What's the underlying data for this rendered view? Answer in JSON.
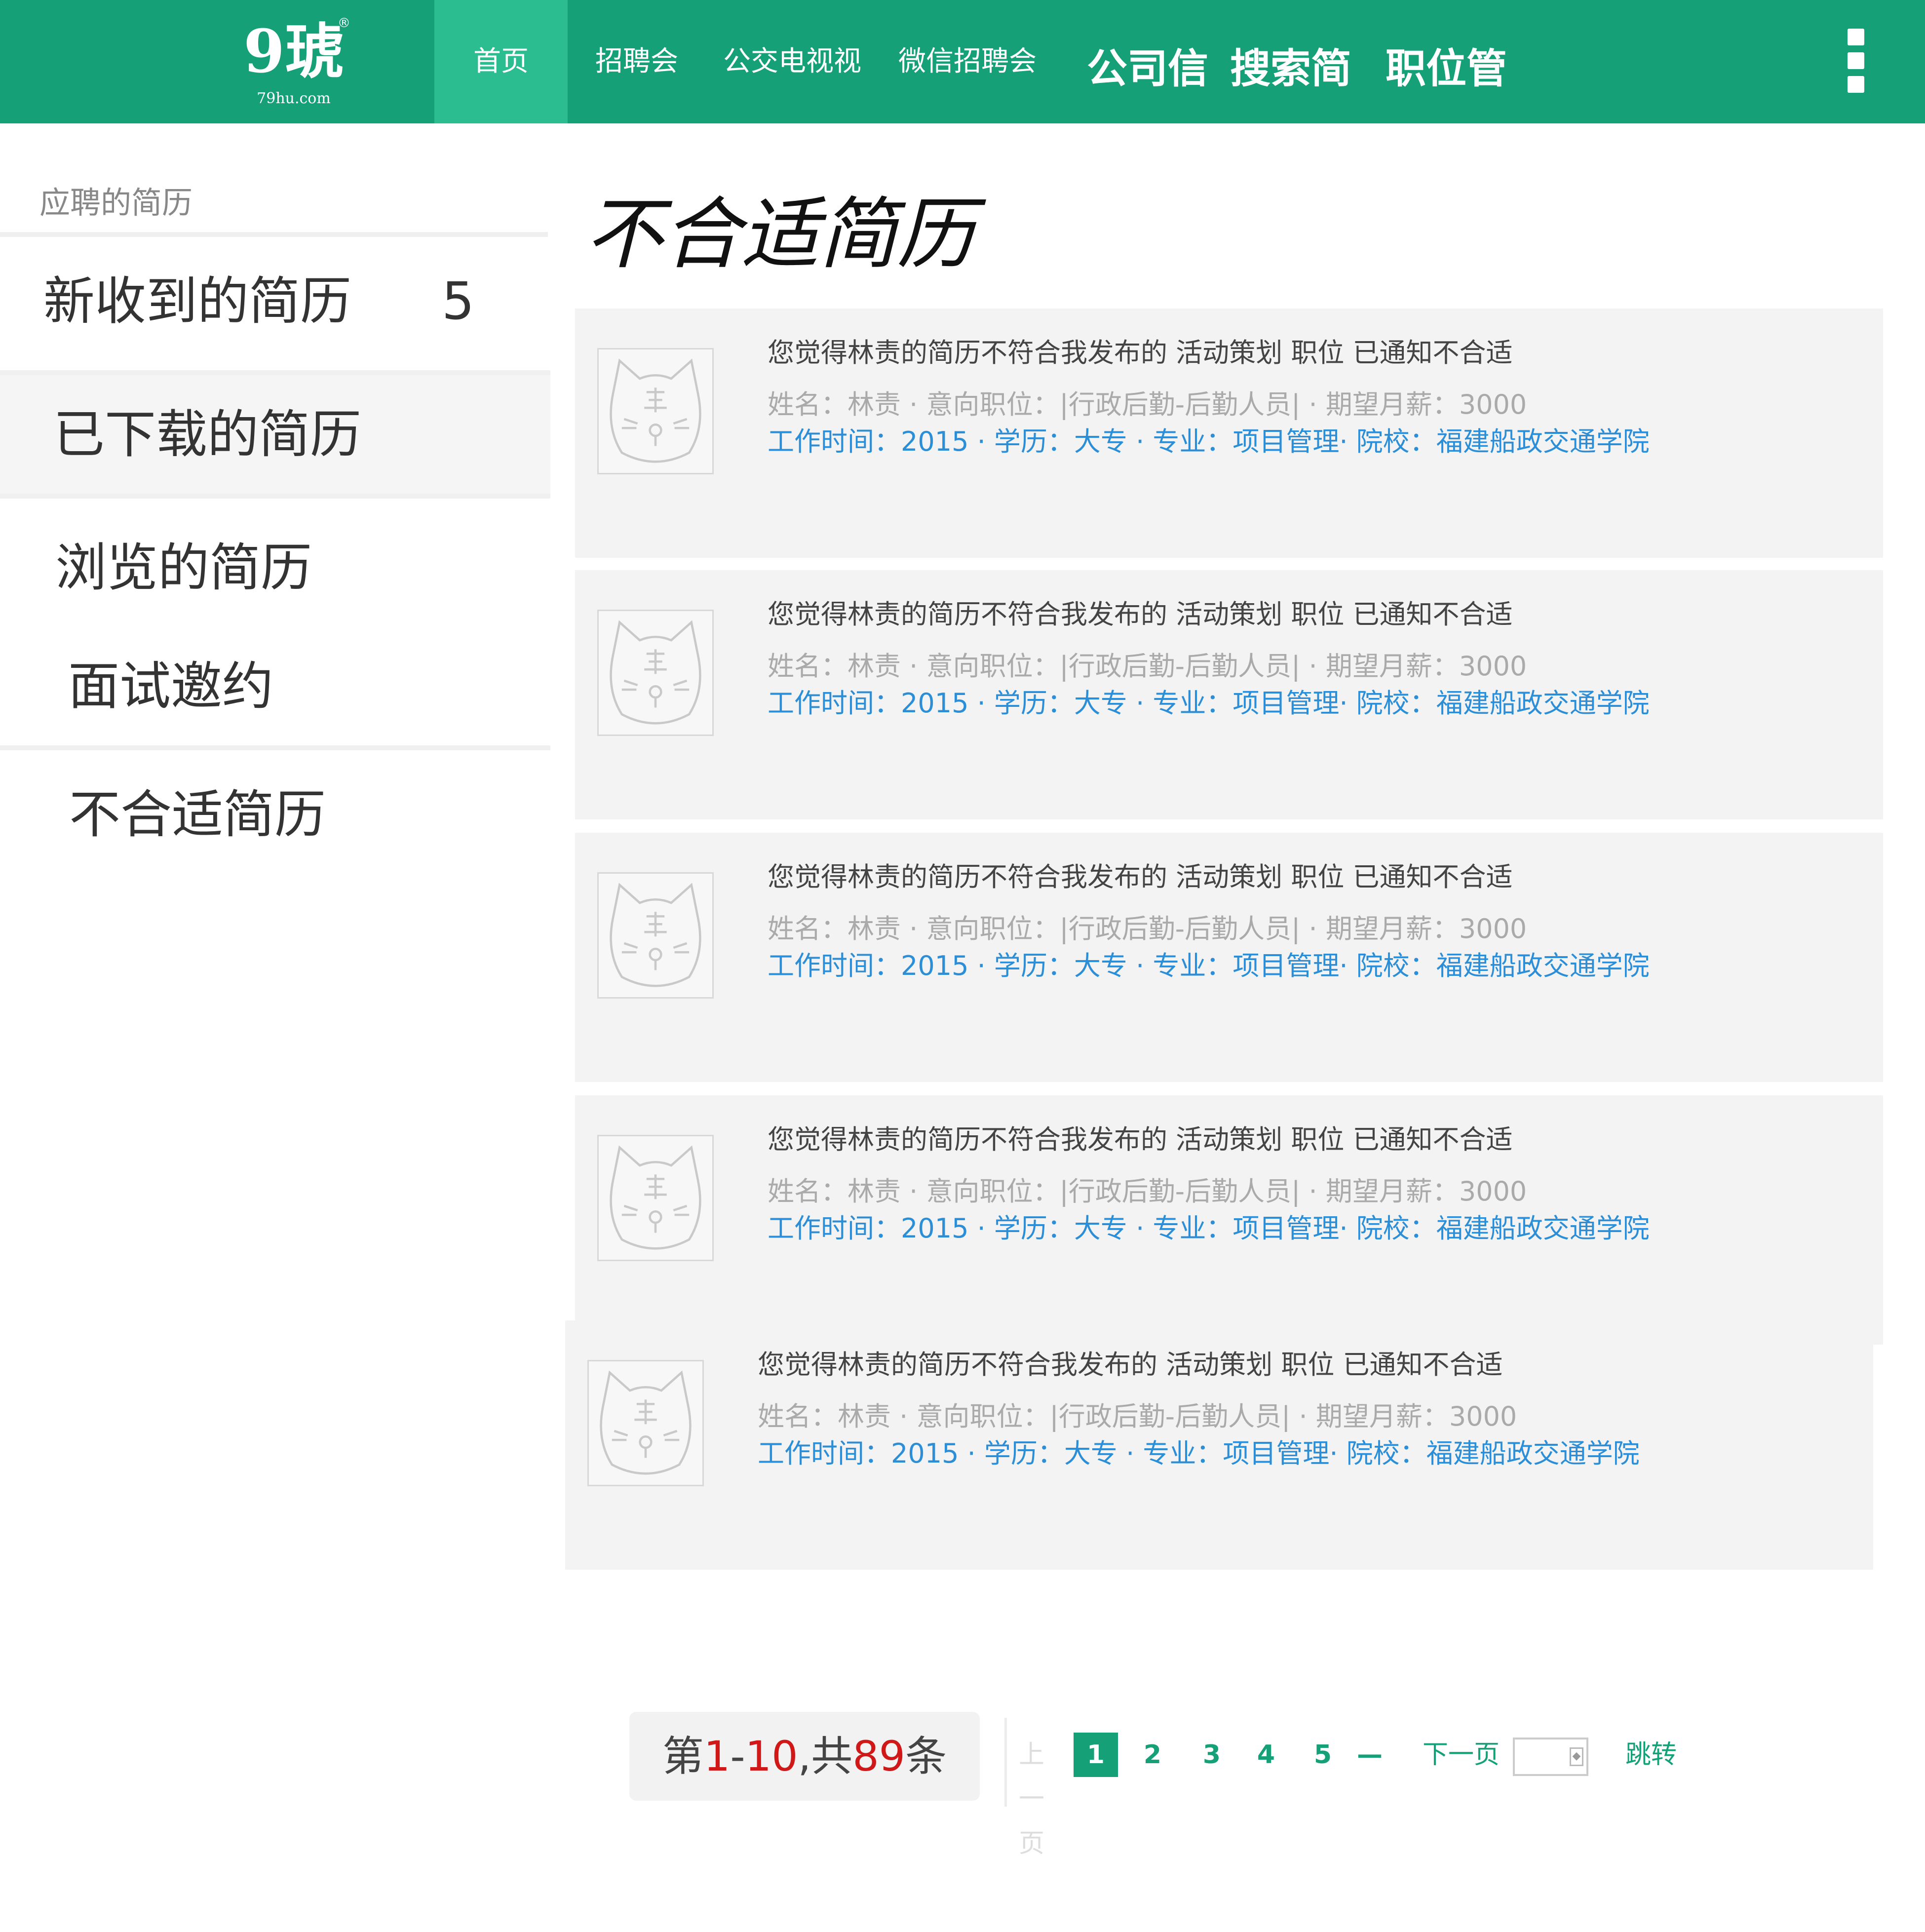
{
  "header": {
    "logo_text": "9琥",
    "logo_domain": "79hu.com",
    "logo_mark": "®",
    "nav": {
      "home": "首页",
      "job_fair": "招聘会",
      "bus_tv": "公交电视视频",
      "wechat_fair": "微信招聘会",
      "company_info": "公司信息",
      "search_resume": "搜索简历",
      "job_manage": "职位管理"
    },
    "menu_icon": "more-vertical-icon",
    "colors": {
      "bar": "#16a078",
      "active": "#2bbd8f"
    }
  },
  "sidebar": {
    "heading": "应聘的简历",
    "items": [
      {
        "label": "新收到的简历",
        "count": "5"
      },
      {
        "label": "已下载的简历"
      },
      {
        "label": "浏览的简历"
      },
      {
        "label": "面试邀约"
      },
      {
        "label": "不合适简历"
      }
    ]
  },
  "main": {
    "title": "不合适简历",
    "cards": [
      {
        "title": "您觉得林责的简历不符合我发布的 活动策划 职位  已通知不合适",
        "info": "姓名：林责 · 意向职位：|行政后勤-后勤人员| · 期望月薪：3000",
        "edu": "工作时间：2015 · 学历：大专 · 专业：项目管理· 院校：福建船政交通学院",
        "avatar_icon": "cat-avatar-icon"
      },
      {
        "title": "您觉得林责的简历不符合我发布的 活动策划 职位  已通知不合适",
        "info": "姓名：林责 · 意向职位：|行政后勤-后勤人员| · 期望月薪：3000",
        "edu": "工作时间：2015 · 学历：大专 · 专业：项目管理· 院校：福建船政交通学院",
        "avatar_icon": "cat-avatar-icon"
      },
      {
        "title": "您觉得林责的简历不符合我发布的 活动策划 职位  已通知不合适",
        "info": "姓名：林责 · 意向职位：|行政后勤-后勤人员| · 期望月薪：3000",
        "edu": "工作时间：2015 · 学历：大专 · 专业：项目管理· 院校：福建船政交通学院",
        "avatar_icon": "cat-avatar-icon"
      },
      {
        "title": "您觉得林责的简历不符合我发布的 活动策划 职位  已通知不合适",
        "info": "姓名：林责 · 意向职位：|行政后勤-后勤人员| · 期望月薪：3000",
        "edu": "工作时间：2015 · 学历：大专 · 专业：项目管理· 院校：福建船政交通学院",
        "avatar_icon": "cat-avatar-icon"
      },
      {
        "title": "您觉得林责的简历不符合我发布的 活动策划 职位  已通知不合适",
        "info": "姓名：林责 · 意向职位：|行政后勤-后勤人员| · 期望月薪：3000",
        "edu": "工作时间：2015 · 学历：大专 · 专业：项目管理· 院校：福建船政交通学院",
        "avatar_icon": "cat-avatar-icon"
      }
    ]
  },
  "pagination": {
    "summary_prefix": "第",
    "range_start": "1",
    "range_sep": "-",
    "range_end": "10",
    "total_prefix": ",共",
    "total": "89",
    "summary_suffix": "条",
    "prev": "上一页",
    "pages": [
      "1",
      "2",
      "3",
      "4",
      "5"
    ],
    "current_page": "1",
    "ellipsis": "—",
    "next": "下一页",
    "go": "跳转",
    "highlight_color": "#d01818"
  }
}
